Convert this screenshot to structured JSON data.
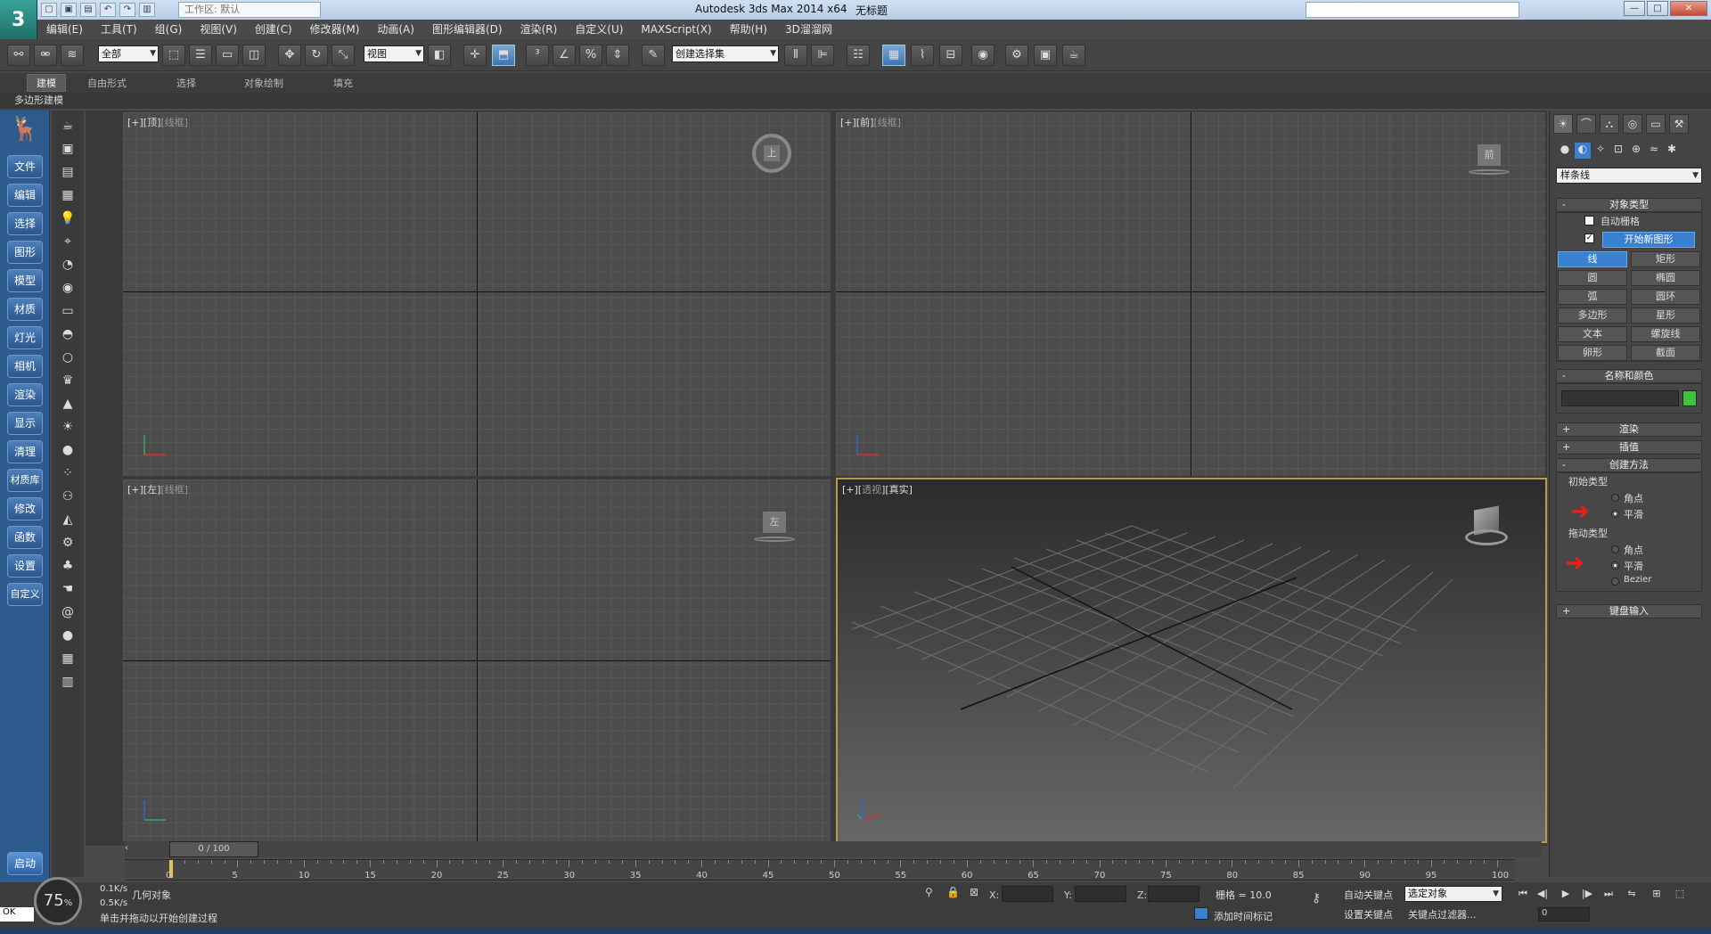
{
  "titlebar": {
    "logo": "3",
    "workspace": "工作区: 默认",
    "app_title": "Autodesk 3ds Max  2014 x64",
    "doc_title": "无标题",
    "min": "—",
    "max": "□",
    "close": "✕"
  },
  "menu": [
    "编辑(E)",
    "工具(T)",
    "组(G)",
    "视图(V)",
    "创建(C)",
    "修改器(M)",
    "动画(A)",
    "图形编辑器(D)",
    "渲染(R)",
    "自定义(U)",
    "MAXScript(X)",
    "帮助(H)",
    "3D溜溜网"
  ],
  "toolbar": {
    "selection_filter": "全部",
    "ref_coord": "视图",
    "named_selection": "创建选择集"
  },
  "ribbon": {
    "tabs": [
      "建模",
      "自由形式",
      "选择",
      "对象绘制",
      "填充"
    ],
    "sub": "多边形建模"
  },
  "leftbar": [
    "文件",
    "编辑",
    "选择",
    "图形",
    "模型",
    "材质",
    "灯光",
    "相机",
    "渲染",
    "显示",
    "清理",
    "材质库",
    "修改",
    "函数",
    "设置",
    "自定义"
  ],
  "leftbar_start": "启动",
  "viewports": {
    "top": {
      "label_a": "[+][顶]",
      "label_b": "[线框]",
      "cube": "上"
    },
    "front": {
      "label_a": "[+][前]",
      "label_b": "[线框]",
      "cube": "前"
    },
    "left": {
      "label_a": "[+][左]",
      "label_b": "[线框]",
      "cube": "左"
    },
    "persp": {
      "label_a": "[+][",
      "label_mid": "透视",
      "label_c": "][真实]"
    }
  },
  "timeline": {
    "slider": "0 / 100",
    "ticks": [
      "0",
      "5",
      "10",
      "15",
      "20",
      "25",
      "30",
      "35",
      "40",
      "45",
      "50",
      "55",
      "60",
      "65",
      "70",
      "75",
      "80",
      "85",
      "90",
      "95",
      "100"
    ]
  },
  "status": {
    "gauge": "75",
    "gauge_unit": "%",
    "rate1": "0.1K/s",
    "rate2": "0.5K/s",
    "cmd_value": "OK",
    "line1": "几何对象",
    "line2": "单击并拖动以开始创建过程",
    "x_label": "X:",
    "y_label": "Y:",
    "z_label": "Z:",
    "grid": "栅格 = 10.0",
    "add_time_tag": "添加时间标记",
    "auto_key": "自动关键点",
    "set_key": "设置关键点",
    "selected_object": "选定对象",
    "key_filter": "关键点过滤器...",
    "frame": "0"
  },
  "cmdpanel": {
    "dropdown": "样条线",
    "object_type": "对象类型",
    "auto_grid": "自动栅格",
    "start_new_shape": "开始新图形",
    "buttons": [
      [
        "线",
        "矩形"
      ],
      [
        "圆",
        "椭圆"
      ],
      [
        "弧",
        "圆环"
      ],
      [
        "多边形",
        "星形"
      ],
      [
        "文本",
        "螺旋线"
      ],
      [
        "卵形",
        "截面"
      ]
    ],
    "name_color": "名称和颜色",
    "swatch_color": "#3cc43c",
    "rendering": "渲染",
    "interpolation": "插值",
    "creation_method": "创建方法",
    "initial_type": "初始类型",
    "corner": "角点",
    "smooth": "平滑",
    "drag_type": "拖动类型",
    "bezier": "Bezier",
    "keyboard_entry": "键盘输入"
  }
}
